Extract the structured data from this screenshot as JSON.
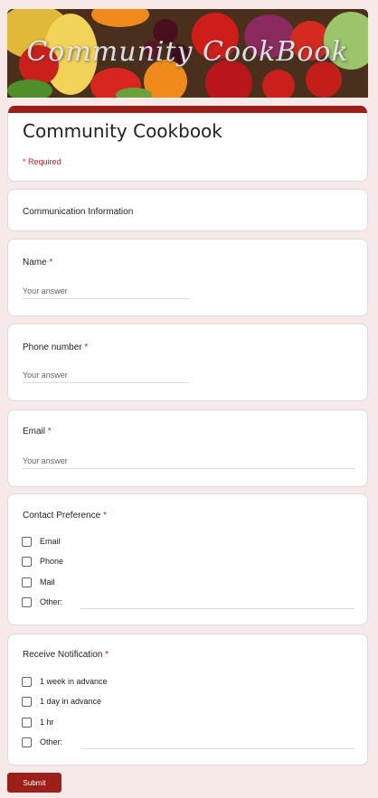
{
  "banner": {
    "text": "Community CookBook"
  },
  "header": {
    "title": "Community Cookbook",
    "required_note": "* Required"
  },
  "section": {
    "title": "Communication Information"
  },
  "questions": {
    "name": {
      "label": "Name",
      "star": "*",
      "placeholder": "Your answer"
    },
    "phone": {
      "label": "Phone number",
      "star": "*",
      "placeholder": "Your answer"
    },
    "email": {
      "label": "Email",
      "star": "*",
      "placeholder": "Your answer"
    },
    "contact": {
      "label": "Contact Preference",
      "star": "*",
      "options": [
        "Email",
        "Phone",
        "Mail",
        "Other:"
      ]
    },
    "notify": {
      "label": "Receive Notification",
      "star": "*",
      "options": [
        "1 week in advance",
        "1 day in advance",
        "1 hr",
        "Other:"
      ]
    }
  },
  "submit_label": "Submit",
  "colors": {
    "accent": "#9c1f1a",
    "background": "#f6e9e8"
  }
}
